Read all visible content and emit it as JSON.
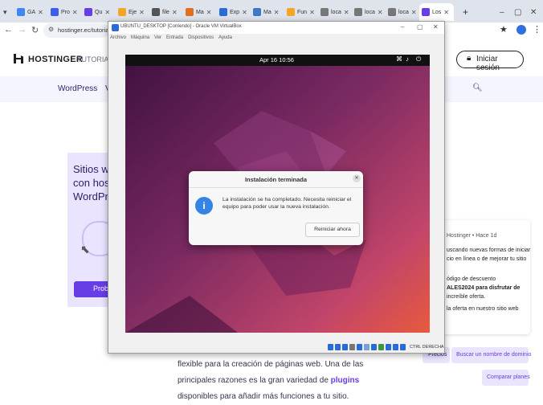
{
  "browser": {
    "tabs": [
      {
        "label": "GA",
        "color": "#4285f4"
      },
      {
        "label": "Pro",
        "color": "#3a5ee6"
      },
      {
        "label": "Qu",
        "color": "#673de6"
      },
      {
        "label": "Eje",
        "color": "#f5a623"
      },
      {
        "label": "file",
        "color": "#555555"
      },
      {
        "label": "Ma",
        "color": "#e07020"
      },
      {
        "label": "Exp",
        "color": "#2a6bd8"
      },
      {
        "label": "Ma",
        "color": "#3a78c8"
      },
      {
        "label": "Fun",
        "color": "#f5a623"
      },
      {
        "label": "loca",
        "color": "#777777"
      },
      {
        "label": "loca",
        "color": "#777777"
      },
      {
        "label": "loca",
        "color": "#777777"
      },
      {
        "label": "Los",
        "color": "#673de6",
        "active": true
      }
    ],
    "address": "hostinger.ec/tutoriales"
  },
  "site": {
    "logo_text": "HOSTINGER",
    "logo_sub": "TUTORIALES",
    "login_label": "Iniciar sesión",
    "nav_wordpress": "WordPress",
    "nav_v": "V",
    "promo_title_lines": [
      "Sitios we",
      "con hos",
      "WordPre"
    ],
    "promo_button": "Probar",
    "article_lines": [
      "flexible para la creación de páginas web. Una de las",
      "principales razones es la gran variedad de plugins",
      "disponibles para añadir más funciones a tu sitio."
    ],
    "plugins_link": "plugins",
    "sidebar": {
      "meta": "Hostinger • Hace 1d",
      "lines": [
        "uscando nuevas formas de iniciar",
        "cio en línea o de mejorar tu sitio",
        "ódigo de descuento",
        "ALES2024 para disfrutar de",
        "increíble oferta.",
        "la oferta en nuestro sitio web"
      ]
    },
    "bottom_buttons": [
      "Precios",
      "Buscar un nombre de dominio",
      "Comparar planes"
    ]
  },
  "vbox": {
    "title": "UBUNTU_DESKTOP [Corriendo] - Oracle VM VirtualBox",
    "menu": [
      "Archivo",
      "Máquina",
      "Ver",
      "Entrada",
      "Dispositivos",
      "Ayuda"
    ],
    "host_key": "CTRL DERECHA"
  },
  "ubuntu": {
    "clock": "Apr 16  10:56",
    "dialog_title": "Instalación terminada",
    "dialog_message": "La instalación se ha completado. Necesita reiniciar el equipo para poder usar la nueva instalación.",
    "restart_label": "Reiniciar ahora"
  }
}
